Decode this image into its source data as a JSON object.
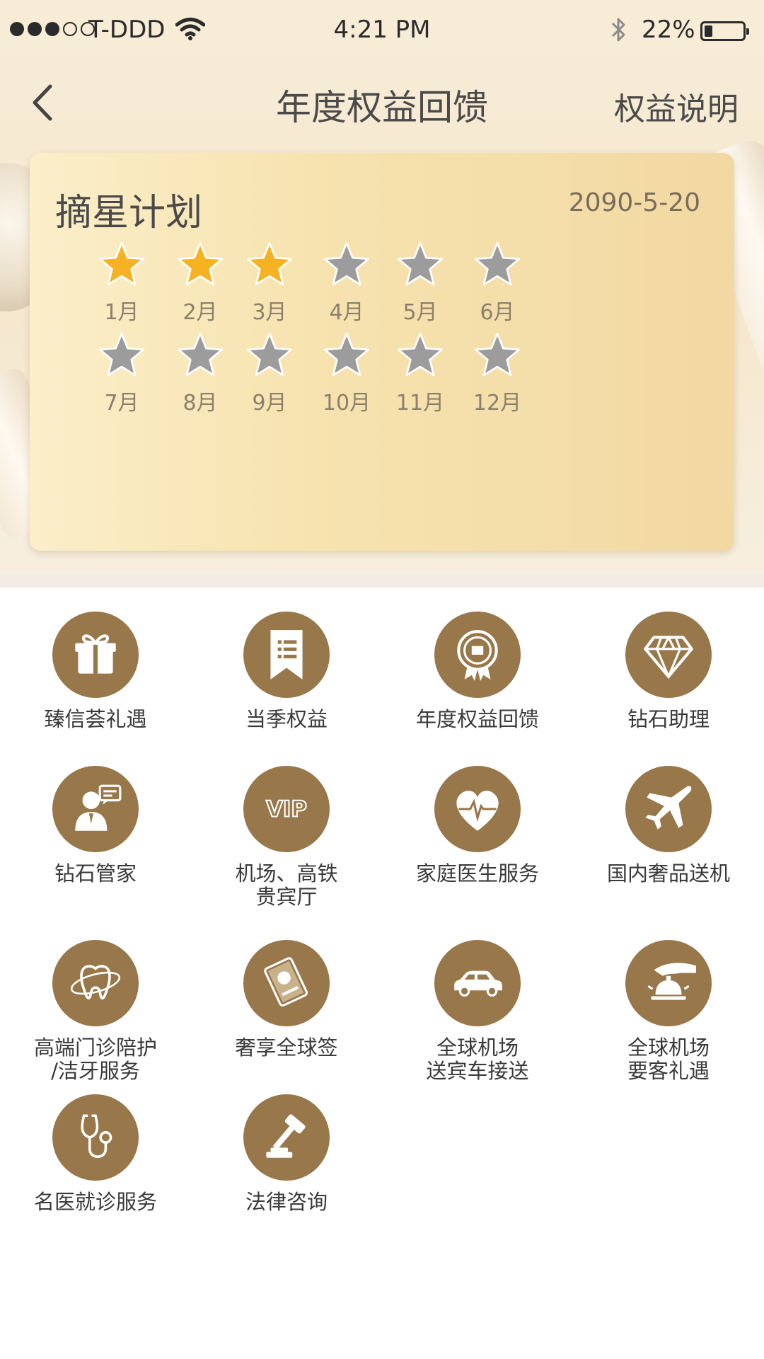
{
  "status_bar": {
    "carrier": "T-DDD",
    "time": "4:21 PM",
    "battery": "22%",
    "battery_level": 0.22,
    "signal_bars": 3,
    "signal_total": 5
  },
  "nav": {
    "title": "年度权益回馈",
    "right_link": "权益说明"
  },
  "card": {
    "title": "摘星计划",
    "date": "2090-5-20",
    "star_filled_color": "#f5b324",
    "star_empty_color": "#9c9c9c",
    "months": [
      {
        "label": "1月",
        "earned": true
      },
      {
        "label": "2月",
        "earned": true
      },
      {
        "label": "3月",
        "earned": true
      },
      {
        "label": "4月",
        "earned": false
      },
      {
        "label": "5月",
        "earned": false
      },
      {
        "label": "6月",
        "earned": false
      },
      {
        "label": "7月",
        "earned": false
      },
      {
        "label": "8月",
        "earned": false
      },
      {
        "label": "9月",
        "earned": false
      },
      {
        "label": "10月",
        "earned": false
      },
      {
        "label": "11月",
        "earned": false
      },
      {
        "label": "12月",
        "earned": false
      }
    ]
  },
  "services": {
    "icon_bg_color": "#98774a",
    "items": [
      {
        "label": "臻信荟礼遇",
        "icon": "gift-icon"
      },
      {
        "label": "当季权益",
        "icon": "ribbon-list-icon"
      },
      {
        "label": "年度权益回馈",
        "icon": "award-badge-icon"
      },
      {
        "label": "钻石助理",
        "icon": "diamond-icon"
      },
      {
        "label": "钻石管家",
        "icon": "butler-icon"
      },
      {
        "label": "机场、高铁\n贵宾厅",
        "icon": "vip-icon"
      },
      {
        "label": "家庭医生服务",
        "icon": "heart-pulse-icon"
      },
      {
        "label": "国内奢品送机",
        "icon": "airplane-icon"
      },
      {
        "label": "高端门诊陪护\n/洁牙服务",
        "icon": "tooth-icon"
      },
      {
        "label": "奢享全球签",
        "icon": "passport-icon"
      },
      {
        "label": "全球机场\n送宾车接送",
        "icon": "car-icon"
      },
      {
        "label": "全球机场\n要客礼遇",
        "icon": "service-bell-icon"
      },
      {
        "label": "名医就诊服务",
        "icon": "stethoscope-icon"
      },
      {
        "label": "法律咨询",
        "icon": "gavel-icon"
      }
    ]
  }
}
